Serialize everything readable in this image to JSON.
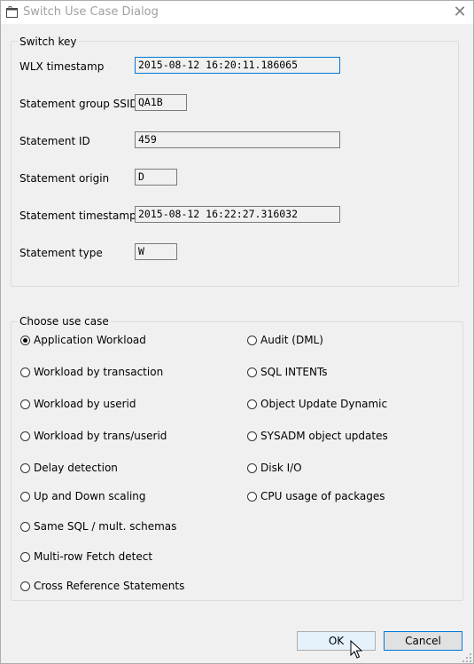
{
  "window": {
    "title": "Switch Use Case Dialog",
    "app_icon": "window-icon",
    "close_glyph": "✕"
  },
  "switch_key": {
    "legend": "Switch key",
    "fields": [
      {
        "label": "WLX timestamp",
        "value": "2015-08-12 16:20:11.186065"
      },
      {
        "label": "Statement group SSID",
        "value": "QA1B"
      },
      {
        "label": "Statement ID",
        "value": "459"
      },
      {
        "label": "Statement origin",
        "value": "D"
      },
      {
        "label": "Statement timestamp",
        "value": "2015-08-12 16:22:27.316032"
      },
      {
        "label": "Statement type",
        "value": "W"
      }
    ]
  },
  "use_case": {
    "legend": "Choose use case",
    "selected": "Application Workload",
    "left_options": [
      "Application Workload",
      "Workload by transaction",
      "Workload by userid",
      "Workload by trans/userid",
      "Delay detection",
      "Up and Down scaling",
      "Same SQL / mult. schemas",
      "Multi-row Fetch detect",
      "Cross Reference Statements"
    ],
    "right_options": [
      "Audit (DML)",
      "SQL INTENTs",
      "Object Update Dynamic",
      "SYSADM object updates",
      "Disk I/O",
      "CPU usage of packages"
    ]
  },
  "buttons": {
    "ok": "OK",
    "cancel": "Cancel"
  },
  "colors": {
    "focus_border": "#0078d7",
    "title_text": "#a0a0a0"
  },
  "icons": [
    "window-icon",
    "close-icon",
    "mouse-pointer-icon",
    "resize-grip-icon"
  ]
}
